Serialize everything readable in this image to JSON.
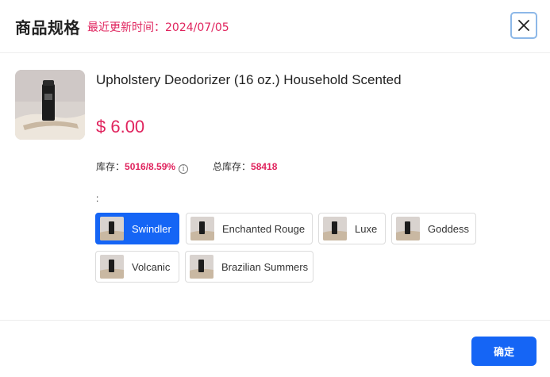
{
  "header": {
    "title": "商品规格",
    "update_text": "最近更新时间：2024/07/05"
  },
  "product": {
    "name": "Upholstery Deodorizer (16 oz.) Household Scented",
    "price": "$ 6.00",
    "stock_label": "库存：",
    "stock_value": "5016/8.59%",
    "total_stock_label": "总库存：",
    "total_stock_value": "58418"
  },
  "spec": {
    "label": ":",
    "selected": "Swindler",
    "options": [
      {
        "label": "Swindler"
      },
      {
        "label": "Enchanted Rouge"
      },
      {
        "label": "Luxe"
      },
      {
        "label": "Goddess"
      },
      {
        "label": "Volcanic"
      },
      {
        "label": "Brazilian Summers"
      }
    ]
  },
  "footer": {
    "confirm_label": "确定"
  },
  "colors": {
    "accent_blue": "#1565f5",
    "price_pink": "#e0245e"
  },
  "icons": [
    "close-icon",
    "info-icon",
    "product-thumbnail"
  ]
}
